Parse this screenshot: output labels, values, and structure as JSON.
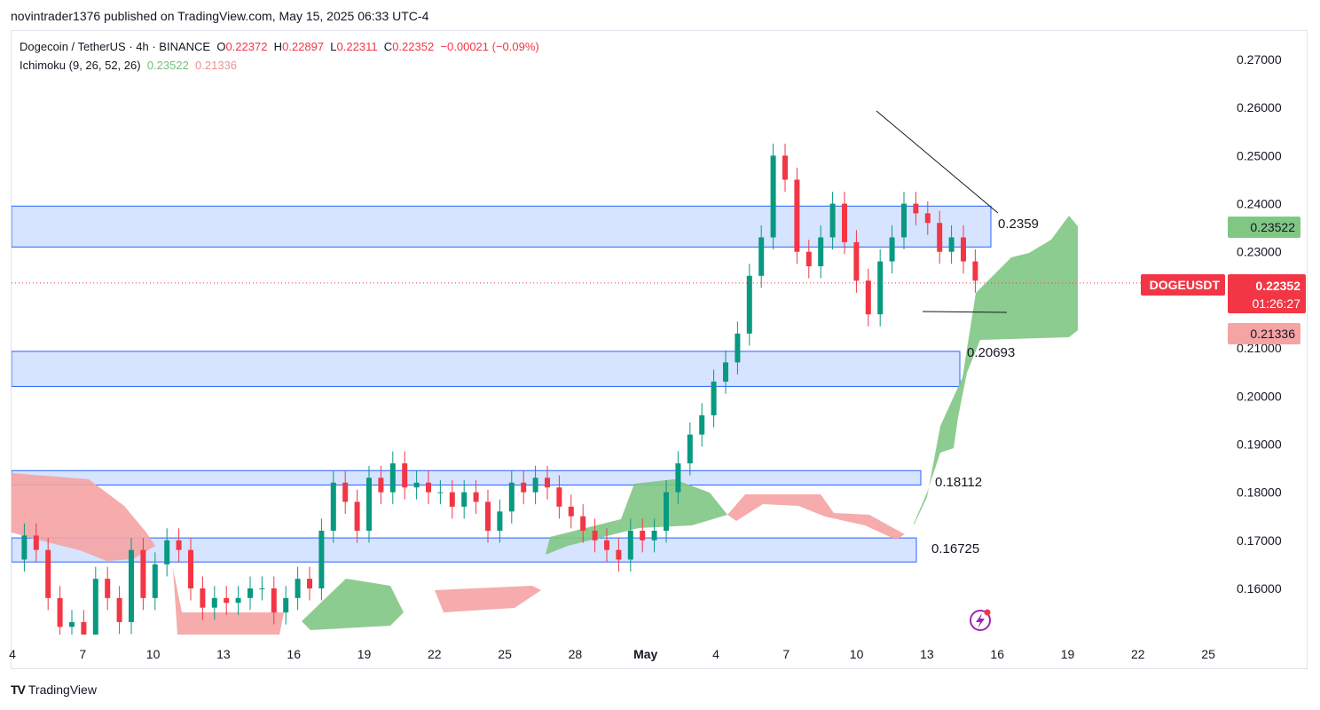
{
  "header": {
    "published": "novintrader1376 published on TradingView.com, May 15, 2025 06:33 UTC-4"
  },
  "legend": {
    "symbol": "Dogecoin / TetherUS · 4h · BINANCE",
    "o_label": "O",
    "o": "0.22372",
    "h_label": "H",
    "h": "0.22897",
    "l_label": "L",
    "l": "0.22311",
    "c_label": "C",
    "c": "0.22352",
    "change": "−0.00021 (−0.09%)",
    "indicator": "Ichimoku (9, 26, 52, 26)",
    "ind_val1": "0.23522",
    "ind_val2": "0.21336"
  },
  "price_axis": {
    "ticks": [
      "0.27000",
      "0.26000",
      "0.25000",
      "0.24000",
      "0.23000",
      "0.21000",
      "0.20000",
      "0.19000",
      "0.18000",
      "0.17000",
      "0.16000"
    ],
    "badge_green": "0.23522",
    "badge_symbol": "DOGEUSDT",
    "badge_price": "0.22352",
    "badge_timer": "01:26:27",
    "badge_red": "0.21336"
  },
  "time_axis": {
    "ticks": [
      "4",
      "7",
      "10",
      "13",
      "16",
      "19",
      "22",
      "25",
      "28",
      "May",
      "4",
      "7",
      "10",
      "13",
      "16",
      "19",
      "22",
      "25"
    ]
  },
  "annotations": {
    "zone1": "0.2359",
    "zone2": "0.20693",
    "zone3": "0.18112",
    "zone4": "0.16725"
  },
  "colors": {
    "up": "#26a69a",
    "candle_up": "#089981",
    "down": "#f23645",
    "cloud_green": "#81c784",
    "cloud_red": "#f5a3a3",
    "zone_fill": "#d6e4ff",
    "zone_border": "#2962ff",
    "last_price": "#f23645"
  },
  "brand": {
    "logo": "TV",
    "name": "TradingView"
  },
  "chart_data": {
    "type": "candlestick",
    "title": "Dogecoin / TetherUS · 4h · BINANCE",
    "ylim": [
      0.1505,
      0.2755
    ],
    "x_ticks": [
      "Apr 4",
      "Apr 7",
      "Apr 10",
      "Apr 13",
      "Apr 16",
      "Apr 19",
      "Apr 22",
      "Apr 25",
      "Apr 28",
      "May",
      "May 4",
      "May 7",
      "May 10",
      "May 13",
      "May 16",
      "May 19",
      "May 22",
      "May 25"
    ],
    "last_price": 0.22352,
    "ichimoku": {
      "span_a": 0.23522,
      "span_b": 0.21336
    },
    "price_path": [
      [
        0,
        0.166
      ],
      [
        1,
        0.171
      ],
      [
        2,
        0.168
      ],
      [
        3,
        0.158
      ],
      [
        4,
        0.152
      ],
      [
        5,
        0.153
      ],
      [
        6,
        0.15
      ],
      [
        7,
        0.162
      ],
      [
        8,
        0.158
      ],
      [
        9,
        0.153
      ],
      [
        10,
        0.168
      ],
      [
        11,
        0.158
      ],
      [
        12,
        0.165
      ],
      [
        13,
        0.17
      ],
      [
        14,
        0.168
      ],
      [
        15,
        0.16
      ],
      [
        16,
        0.156
      ],
      [
        17,
        0.158
      ],
      [
        18,
        0.157
      ],
      [
        19,
        0.158
      ],
      [
        20,
        0.16
      ],
      [
        21,
        0.16
      ],
      [
        22,
        0.155
      ],
      [
        23,
        0.158
      ],
      [
        24,
        0.162
      ],
      [
        25,
        0.16
      ],
      [
        26,
        0.172
      ],
      [
        27,
        0.182
      ],
      [
        28,
        0.178
      ],
      [
        29,
        0.172
      ],
      [
        30,
        0.183
      ],
      [
        31,
        0.18
      ],
      [
        32,
        0.186
      ],
      [
        33,
        0.181
      ],
      [
        34,
        0.182
      ],
      [
        35,
        0.18
      ],
      [
        36,
        0.18
      ],
      [
        37,
        0.177
      ],
      [
        38,
        0.18
      ],
      [
        39,
        0.178
      ],
      [
        40,
        0.172
      ],
      [
        41,
        0.176
      ],
      [
        42,
        0.182
      ],
      [
        43,
        0.18
      ],
      [
        44,
        0.183
      ],
      [
        45,
        0.181
      ],
      [
        46,
        0.177
      ],
      [
        47,
        0.175
      ],
      [
        48,
        0.172
      ],
      [
        49,
        0.17
      ],
      [
        50,
        0.168
      ],
      [
        51,
        0.166
      ],
      [
        52,
        0.172
      ],
      [
        53,
        0.17
      ],
      [
        54,
        0.172
      ],
      [
        55,
        0.18
      ],
      [
        56,
        0.186
      ],
      [
        57,
        0.192
      ],
      [
        58,
        0.196
      ],
      [
        59,
        0.203
      ],
      [
        60,
        0.207
      ],
      [
        61,
        0.213
      ],
      [
        62,
        0.225
      ],
      [
        63,
        0.233
      ],
      [
        64,
        0.25
      ],
      [
        65,
        0.245
      ],
      [
        66,
        0.23
      ],
      [
        67,
        0.227
      ],
      [
        68,
        0.233
      ],
      [
        69,
        0.24
      ],
      [
        70,
        0.232
      ],
      [
        71,
        0.224
      ],
      [
        72,
        0.217
      ],
      [
        73,
        0.228
      ],
      [
        74,
        0.233
      ],
      [
        75,
        0.24
      ],
      [
        76,
        0.238
      ],
      [
        77,
        0.236
      ],
      [
        78,
        0.23
      ],
      [
        79,
        0.233
      ],
      [
        80,
        0.228
      ],
      [
        81,
        0.224
      ]
    ],
    "levels": [
      0.2359,
      0.20693,
      0.18112,
      0.16725
    ],
    "trendline": [
      [
        0.2595
      ],
      [
        0.239
      ]
    ]
  }
}
